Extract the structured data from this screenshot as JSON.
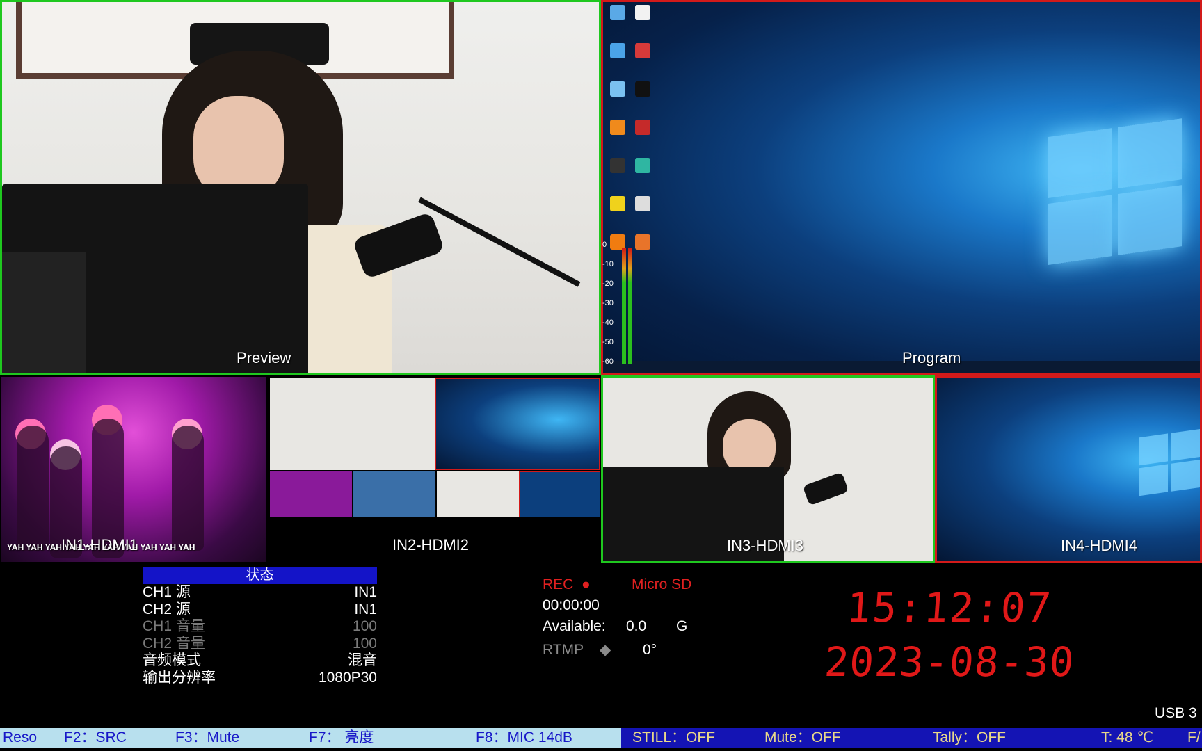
{
  "panes": {
    "preview_label": "Preview",
    "program_label": "Program",
    "in1_label": "IN1-HDMI1",
    "in2_label": "IN2-HDMI2",
    "in3_label": "IN3-HDMI3",
    "in4_label": "IN4-HDMI4",
    "in1_caption": "YAH YAH YAH YAH YAH YAH YAH YAH YAH YAH"
  },
  "meter_ticks": [
    "0",
    "-10",
    "-20",
    "-30",
    "-40",
    "-50",
    "-60"
  ],
  "status": {
    "header": "状态",
    "rows": [
      {
        "label": "CH1 源",
        "value": "IN1"
      },
      {
        "label": "CH2 源",
        "value": "IN1"
      },
      {
        "label": "CH1 音量",
        "value": "100"
      },
      {
        "label": "CH2 音量",
        "value": "100"
      },
      {
        "label": "音频模式",
        "value": "混音"
      },
      {
        "label": "输出分辨率",
        "value": "1080P30"
      }
    ]
  },
  "recording": {
    "rec_label": "REC",
    "storage": "Micro SD",
    "elapsed": "00:00:00",
    "available_label": "Available:",
    "available_value": "0.0",
    "available_unit": "G",
    "rtmp_label": "RTMP",
    "rtmp_value": "0°"
  },
  "clock": {
    "time": "15:12:07",
    "date": "2023-08-30"
  },
  "usb": "USB 3",
  "bottom_bar": {
    "reso": "Reso",
    "f2": "F2：SRC",
    "f3": "F3：Mute",
    "f7": "F7： 亮度",
    "f8": "F8：MIC  14dB",
    "still": "STILL：OFF",
    "mute": "Mute：OFF",
    "tally": "Tally：OFF",
    "temp": "T: 48 ℃",
    "fa": "F/"
  },
  "colors": {
    "preview_border": "#1fc81f",
    "program_border": "#d21a1a",
    "status_header_bg": "#1414c8",
    "clock_color": "#e01818"
  }
}
